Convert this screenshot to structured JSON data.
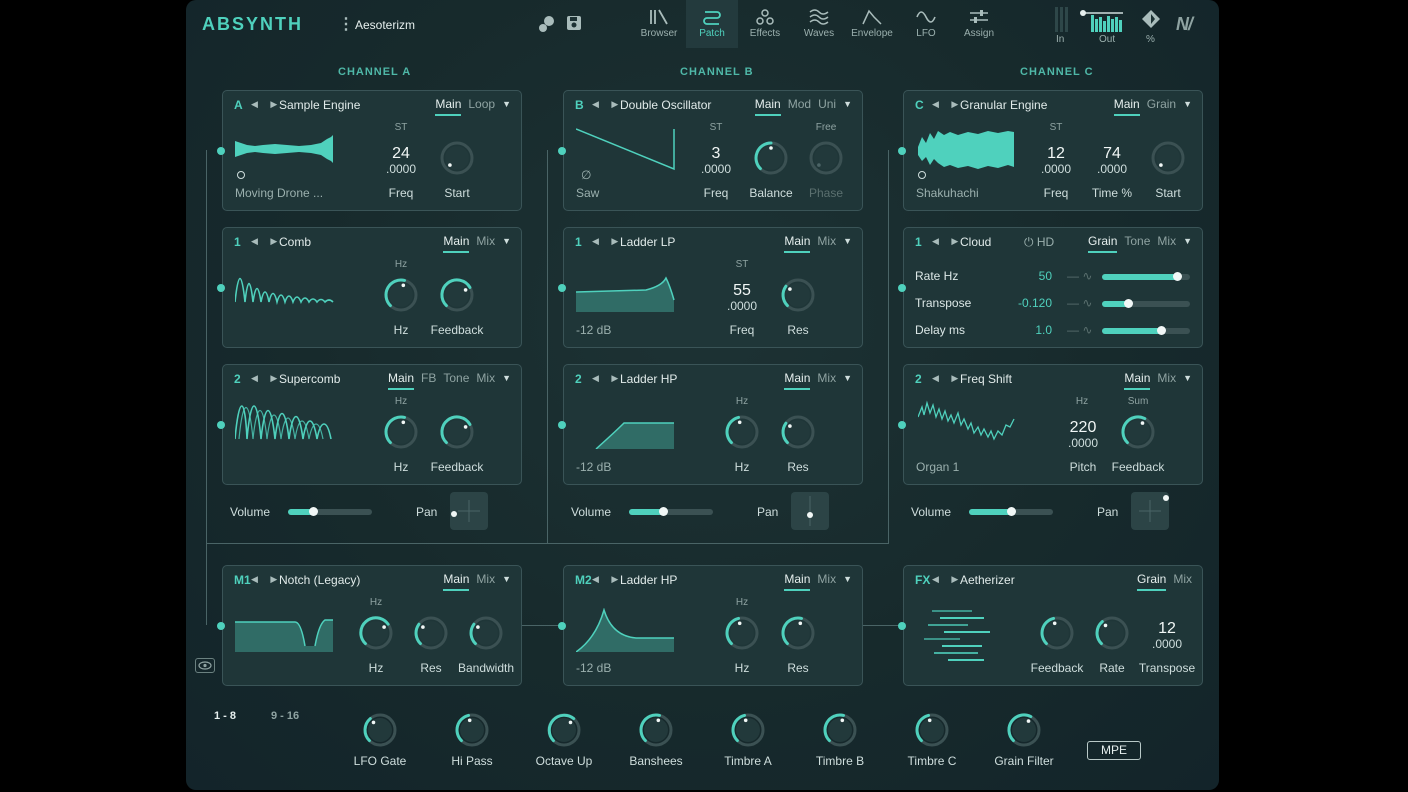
{
  "header": {
    "logo": "ABSYNTH",
    "patch_name": "Aesoterizm",
    "nav_tabs": [
      {
        "label": "Browser",
        "icon": "library-icon"
      },
      {
        "label": "Patch",
        "icon": "patch-icon",
        "active": true
      },
      {
        "label": "Effects",
        "icon": "effects-icon"
      },
      {
        "label": "Waves",
        "icon": "waves-icon"
      },
      {
        "label": "Envelope",
        "icon": "envelope-icon"
      },
      {
        "label": "LFO",
        "icon": "lfo-icon"
      },
      {
        "label": "Assign",
        "icon": "assign-icon"
      }
    ],
    "meters": {
      "in_label": "In",
      "out_label": "Out",
      "percent_label": "%"
    }
  },
  "channels": [
    {
      "title": "CHANNEL A",
      "osc": {
        "badge": "A",
        "title": "Sample Engine",
        "tabs": [
          "Main",
          "Loop"
        ],
        "unit": "ST",
        "value": "24",
        "fraction": ".0000",
        "source": "Moving Drone ...",
        "knob1": "Freq",
        "knob2": "Start",
        "knob2_level": 0.0
      },
      "fx1": {
        "badge": "1",
        "title": "Comb",
        "tabs": [
          "Main",
          "Mix"
        ],
        "unit": "Hz",
        "knob1": "Hz",
        "knob2": "Feedback",
        "knob1_level": 0.55,
        "knob2_level": 0.72
      },
      "fx2": {
        "badge": "2",
        "title": "Supercomb",
        "tabs": [
          "Main",
          "FB",
          "Tone",
          "Mix"
        ],
        "unit": "Hz",
        "knob1": "Hz",
        "knob2": "Feedback",
        "knob1_level": 0.55,
        "knob2_level": 0.72
      },
      "volume_label": "Volume",
      "pan_label": "Pan",
      "volume": 0.3
    },
    {
      "title": "CHANNEL B",
      "osc": {
        "badge": "B",
        "title": "Double Oscillator",
        "tabs": [
          "Main",
          "Mod",
          "Uni"
        ],
        "unit": "ST",
        "unit2": "Free",
        "value": "3",
        "fraction": ".0000",
        "source": "Saw",
        "phase_symbol": "∅",
        "knob1": "Freq",
        "knob2": "Balance",
        "knob3": "Phase",
        "knob2_level": 0.5
      },
      "fx1": {
        "badge": "1",
        "title": "Ladder LP",
        "tabs": [
          "Main",
          "Mix"
        ],
        "unit": "ST",
        "value": "55",
        "fraction": ".0000",
        "gain": "-12 dB",
        "knob1": "Freq",
        "knob2": "Res",
        "knob2_level": 0.3
      },
      "fx2": {
        "badge": "2",
        "title": "Ladder HP",
        "tabs": [
          "Main",
          "Mix"
        ],
        "unit": "Hz",
        "gain": "-12 dB",
        "knob1": "Hz",
        "knob2": "Res",
        "knob1_level": 0.45,
        "knob2_level": 0.3
      },
      "volume_label": "Volume",
      "pan_label": "Pan",
      "volume": 0.4
    },
    {
      "title": "CHANNEL C",
      "osc": {
        "badge": "C",
        "title": "Granular Engine",
        "tabs": [
          "Main",
          "Grain"
        ],
        "unit": "ST",
        "value": "12",
        "fraction": ".0000",
        "value2": "74",
        "fraction2": ".0000",
        "source": "Shakuhachi",
        "knob1": "Freq",
        "knob2": "Time %",
        "knob3": "Start",
        "knob3_level": 0.0
      },
      "fx1": {
        "badge": "1",
        "title": "Cloud",
        "hd_label": "HD",
        "tabs": [
          "Grain",
          "Tone",
          "Mix"
        ],
        "rows": [
          {
            "label": "Rate Hz",
            "value": "50",
            "level": 0.85
          },
          {
            "label": "Transpose",
            "value": "-0.120",
            "level": 0.3
          },
          {
            "label": "Delay ms",
            "value": "1.0",
            "level": 0.67
          }
        ]
      },
      "fx2": {
        "badge": "2",
        "title": "Freq Shift",
        "tabs": [
          "Main",
          "Mix"
        ],
        "unit": "Hz",
        "unit2": "Sum",
        "value": "220",
        "fraction": ".0000",
        "source": "Organ 1",
        "knob1": "Pitch",
        "knob2": "Feedback",
        "knob2_level": 0.6
      },
      "volume_label": "Volume",
      "pan_label": "Pan",
      "volume": 0.5
    }
  ],
  "master": [
    {
      "badge": "M1",
      "title": "Notch (Legacy)",
      "tabs": [
        "Main",
        "Mix"
      ],
      "unit": "Hz",
      "knob1": "Hz",
      "knob2": "Res",
      "knob3": "Bandwidth",
      "knob1_level": 0.7,
      "knob2_level": 0.3,
      "knob3_level": 0.3
    },
    {
      "badge": "M2",
      "title": "Ladder HP",
      "tabs": [
        "Main",
        "Mix"
      ],
      "unit": "Hz",
      "gain": "-12 dB",
      "knob1": "Hz",
      "knob2": "Res",
      "knob1_level": 0.45,
      "knob2_level": 0.55
    },
    {
      "badge": "FX",
      "title": "Aetherizer",
      "tabs": [
        "Grain",
        "Mix"
      ],
      "value": "12",
      "fraction": ".0000",
      "knob1": "Feedback",
      "knob2": "Rate",
      "knob3": "Transpose",
      "knob1_level": 0.45,
      "knob2_level": 0.35
    }
  ],
  "macros": {
    "pages": [
      "1 - 8",
      "9 - 16"
    ],
    "knobs": [
      {
        "label": "LFO Gate",
        "level": 0.35
      },
      {
        "label": "Hi Pass",
        "level": 0.45
      },
      {
        "label": "Octave Up",
        "level": 0.65
      },
      {
        "label": "Banshees",
        "level": 0.55
      },
      {
        "label": "Timbre A",
        "level": 0.45
      },
      {
        "label": "Timbre B",
        "level": 0.55
      },
      {
        "label": "Timbre C",
        "level": 0.45
      },
      {
        "label": "Grain Filter",
        "level": 0.6
      }
    ],
    "mpe_label": "MPE"
  },
  "colors": {
    "accent": "#4fd1bd",
    "panel": "#1f3638",
    "background": "#172a2c"
  }
}
